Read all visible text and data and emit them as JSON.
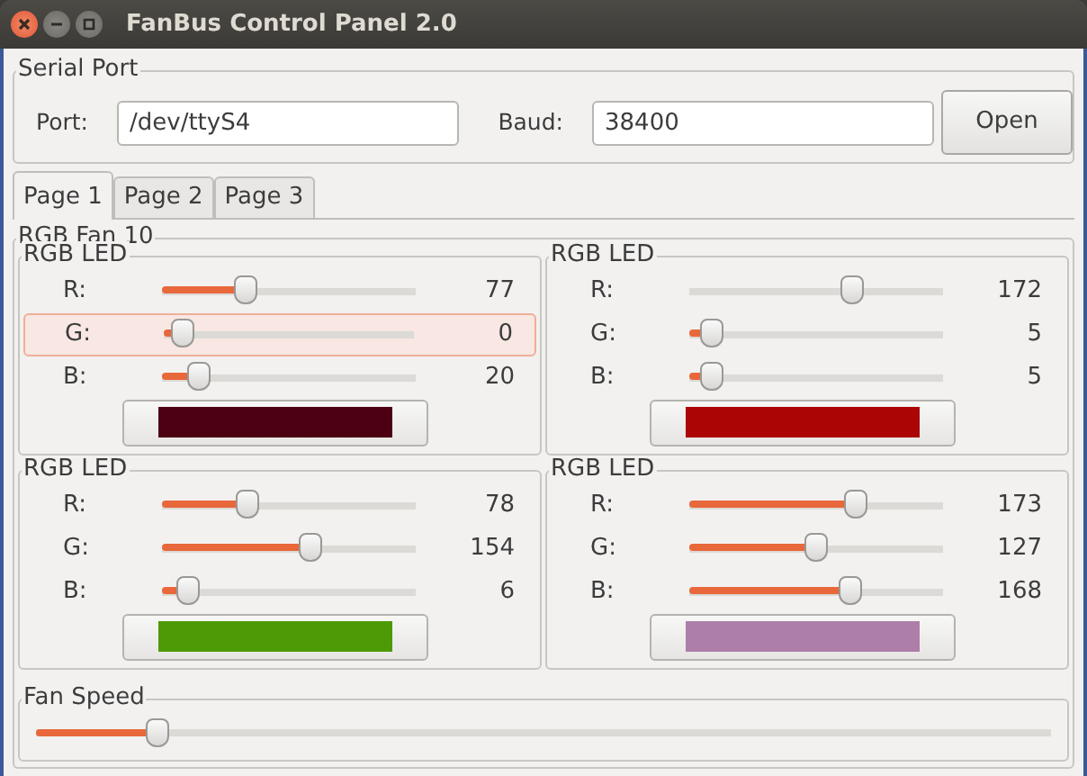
{
  "window": {
    "title": "FanBus Control Panel 2.0"
  },
  "serial_port": {
    "title": "Serial Port",
    "port_label": "Port:",
    "port_value": "/dev/ttyS4",
    "baud_label": "Baud:",
    "baud_value": "38400",
    "open_button": "Open"
  },
  "tabs": [
    {
      "label": "Page 1",
      "selected": true
    },
    {
      "label": "Page 2",
      "selected": false
    },
    {
      "label": "Page 3",
      "selected": false
    }
  ],
  "fan_group": {
    "title": "RGB Fan 10",
    "leds": [
      {
        "title": "RGB LED",
        "color": "#4d0014",
        "channels": [
          {
            "label": "R:",
            "level": 0.3,
            "reading": "77",
            "filled": true,
            "hover": false
          },
          {
            "label": "G:",
            "level": 0,
            "reading": "0",
            "filled": true,
            "hover": true
          },
          {
            "label": "B:",
            "level": 0.08,
            "reading": "20",
            "filled": true,
            "hover": false
          }
        ]
      },
      {
        "title": "RGB LED",
        "color": "#ac0505",
        "channels": [
          {
            "label": "R:",
            "level": 0.67,
            "reading": "172",
            "filled": false,
            "hover": false
          },
          {
            "label": "G:",
            "level": 0.02,
            "reading": "5",
            "filled": true,
            "hover": false
          },
          {
            "label": "B:",
            "level": 0.02,
            "reading": "5",
            "filled": true,
            "hover": false
          }
        ]
      },
      {
        "title": "RGB LED",
        "color": "#4e9a06",
        "channels": [
          {
            "label": "R:",
            "level": 0.31,
            "reading": "78",
            "filled": true,
            "hover": false
          },
          {
            "label": "G:",
            "level": 0.6,
            "reading": "154",
            "filled": true,
            "hover": false
          },
          {
            "label": "B:",
            "level": 0.03,
            "reading": "6",
            "filled": true,
            "hover": false
          }
        ]
      },
      {
        "title": "RGB LED",
        "color": "#ad7fa8",
        "channels": [
          {
            "label": "R:",
            "level": 0.68,
            "reading": "173",
            "filled": true,
            "hover": false
          },
          {
            "label": "G:",
            "level": 0.5,
            "reading": "127",
            "filled": true,
            "hover": false
          },
          {
            "label": "B:",
            "level": 0.66,
            "reading": "168",
            "filled": true,
            "hover": false
          }
        ]
      }
    ],
    "fan_speed": {
      "title": "Fan Speed",
      "level": 0.105
    }
  }
}
